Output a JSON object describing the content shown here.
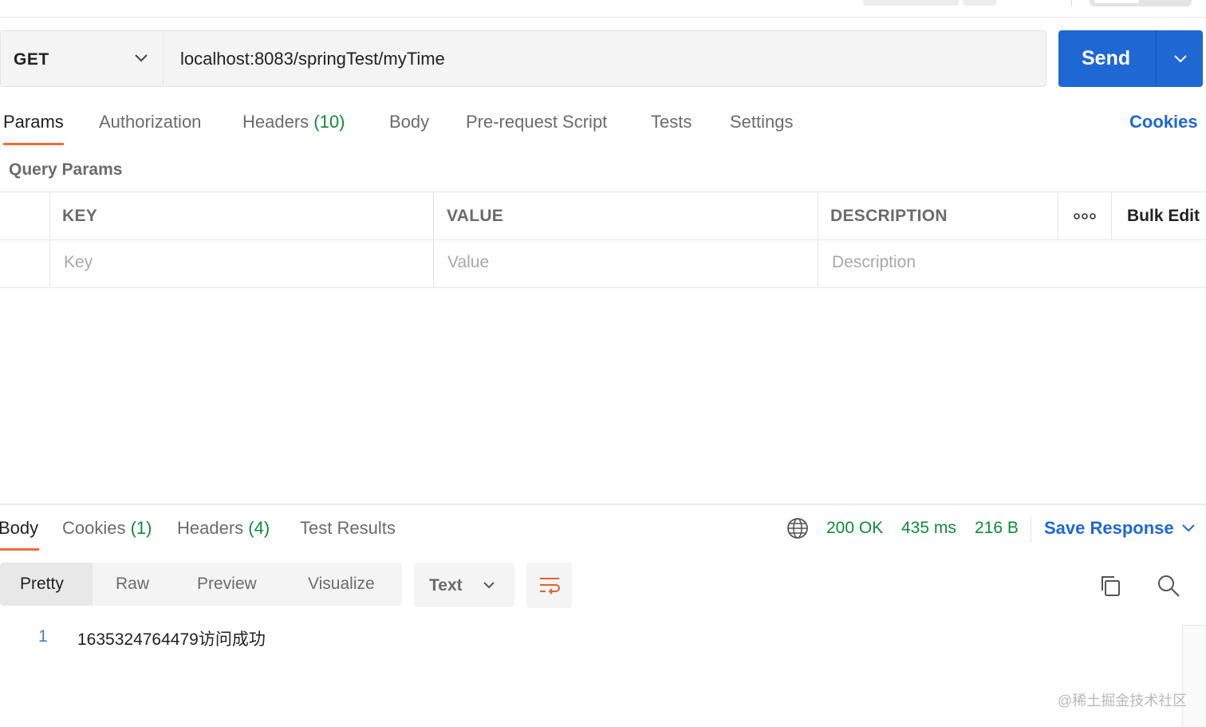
{
  "request": {
    "method": "GET",
    "url": "localhost:8083/springTest/myTime",
    "send_label": "Send"
  },
  "request_tabs": [
    {
      "label": "Params"
    },
    {
      "label": "Authorization"
    },
    {
      "label": "Headers",
      "count": "(10)"
    },
    {
      "label": "Body"
    },
    {
      "label": "Pre-request Script"
    },
    {
      "label": "Tests"
    },
    {
      "label": "Settings"
    }
  ],
  "cookies_link": "Cookies",
  "query_params": {
    "title": "Query Params",
    "headers": {
      "key": "KEY",
      "value": "VALUE",
      "description": "DESCRIPTION",
      "bulk_edit": "Bulk Edit"
    },
    "placeholders": {
      "key": "Key",
      "value": "Value",
      "description": "Description"
    }
  },
  "response_tabs": [
    {
      "label": "Body"
    },
    {
      "label": "Cookies",
      "count": "(1)"
    },
    {
      "label": "Headers",
      "count": "(4)"
    },
    {
      "label": "Test Results"
    }
  ],
  "response_status": {
    "status": "200 OK",
    "time": "435 ms",
    "size": "216 B",
    "save_response": "Save Response"
  },
  "view_modes": [
    "Pretty",
    "Raw",
    "Preview",
    "Visualize"
  ],
  "format": "Text",
  "response_body": {
    "line_number": "1",
    "content": "1635324764479访问成功"
  },
  "watermark": "@稀土掘金技术社区",
  "colors": {
    "accent_blue": "#1f67d3",
    "tab_orange": "#f26b3a",
    "count_green": "#0f8a3a"
  },
  "icons": [
    "chevron-down-icon",
    "globe-icon",
    "wrap-lines-icon",
    "copy-icon",
    "search-icon",
    "more-options-icon"
  ]
}
